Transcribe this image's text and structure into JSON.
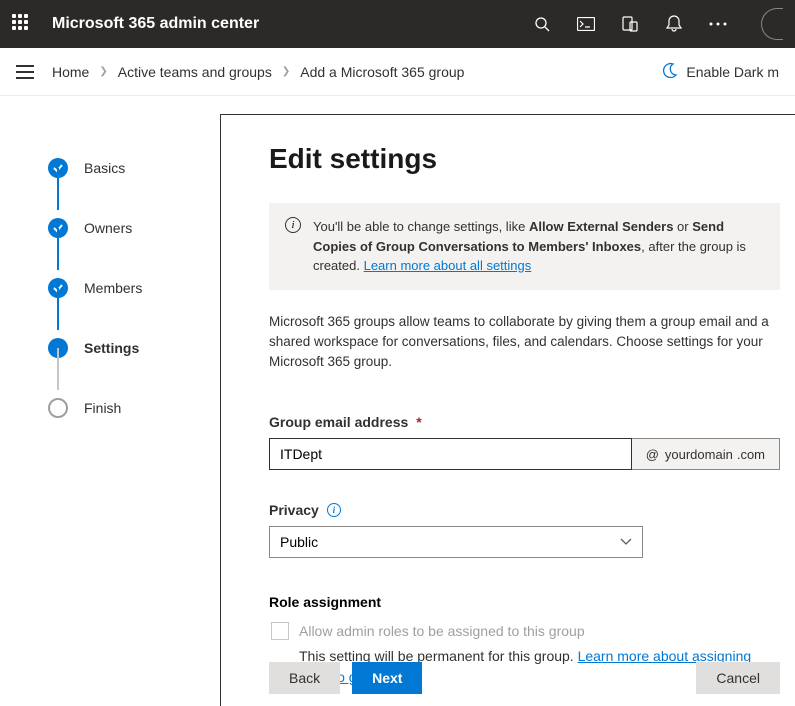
{
  "header": {
    "appTitle": "Microsoft 365 admin center",
    "darkModeLabel": "Enable Dark m"
  },
  "breadcrumb": {
    "items": [
      "Home",
      "Active teams and groups",
      "Add a Microsoft 365 group"
    ]
  },
  "wizard": {
    "steps": [
      {
        "label": "Basics",
        "state": "done"
      },
      {
        "label": "Owners",
        "state": "done"
      },
      {
        "label": "Members",
        "state": "done"
      },
      {
        "label": "Settings",
        "state": "current"
      },
      {
        "label": "Finish",
        "state": "pending"
      }
    ]
  },
  "page": {
    "title": "Edit settings",
    "info_prefix": "You'll be able to change settings, like ",
    "info_bold1": "Allow External Senders",
    "info_mid": " or ",
    "info_bold2": "Send Copies of Group Conversations to Members' Inboxes",
    "info_suffix": ", after the group is created. ",
    "info_link": "Learn more about all settings",
    "description": "Microsoft 365 groups allow teams to collaborate by giving them a group email and a shared workspace for conversations, files, and calendars. Choose settings for your Microsoft 365 group."
  },
  "form": {
    "emailLabel": "Group email address",
    "emailValue": "ITDept",
    "emailDomainAt": "@",
    "emailDomain": "yourdomain",
    "emailTld": ".com",
    "privacyLabel": "Privacy",
    "privacyValue": "Public",
    "roleHeader": "Role assignment",
    "roleCheckboxLabel": "Allow admin roles to be assigned to this group",
    "roleHelperPrefix": "This setting will be permanent for this group. ",
    "roleHelperLink": "Learn more about assigning roles to groups"
  },
  "buttons": {
    "back": "Back",
    "next": "Next",
    "cancel": "Cancel"
  }
}
